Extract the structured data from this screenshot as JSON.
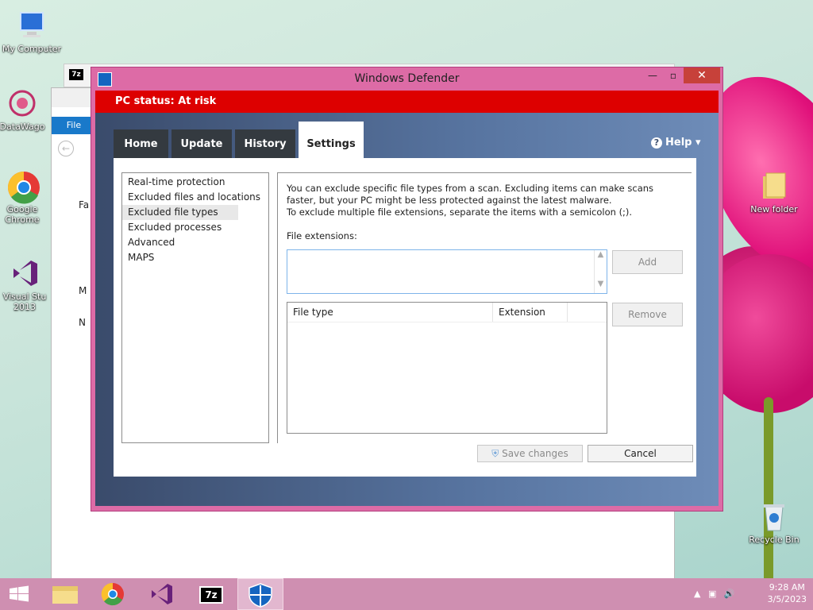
{
  "desktop": {
    "icons": [
      {
        "label": "My Computer"
      },
      {
        "label": "DataWago"
      },
      {
        "label": "Google Chrome"
      },
      {
        "label": "Visual Stu 2013"
      },
      {
        "label": "New folder"
      },
      {
        "label": "Recycle Bin"
      }
    ]
  },
  "explorer": {
    "file_tab": "File",
    "nav_items": [
      "Fa",
      "",
      "",
      "",
      "M",
      "N"
    ]
  },
  "window": {
    "title": "Windows Defender",
    "minimize": "—",
    "maximize": "▫",
    "close": "✕"
  },
  "status": {
    "text": "PC status: At risk",
    "color": "#dd0000"
  },
  "tabs": [
    {
      "label": "Home"
    },
    {
      "label": "Update"
    },
    {
      "label": "History"
    },
    {
      "label": "Settings",
      "active": true
    }
  ],
  "help": {
    "label": "Help"
  },
  "settings_nav": [
    {
      "label": "Real-time protection"
    },
    {
      "label": "Excluded files and locations"
    },
    {
      "label": "Excluded file types",
      "selected": true
    },
    {
      "label": "Excluded processes"
    },
    {
      "label": "Advanced"
    },
    {
      "label": "MAPS"
    }
  ],
  "panel": {
    "description_line1": "You can exclude specific file types from a scan. Excluding items can make scans faster, but your PC might be less protected against the latest malware.",
    "description_line2": "To exclude multiple file extensions, separate the items with a semicolon (;).",
    "extensions_label": "File extensions:",
    "extensions_value": "",
    "add_button": "Add",
    "remove_button": "Remove",
    "table_headers": [
      "File type",
      "Extension"
    ]
  },
  "footer": {
    "save_button": "Save changes",
    "cancel_button": "Cancel"
  },
  "taskbar": {
    "time": "9:28 AM",
    "date": "3/5/2023"
  }
}
